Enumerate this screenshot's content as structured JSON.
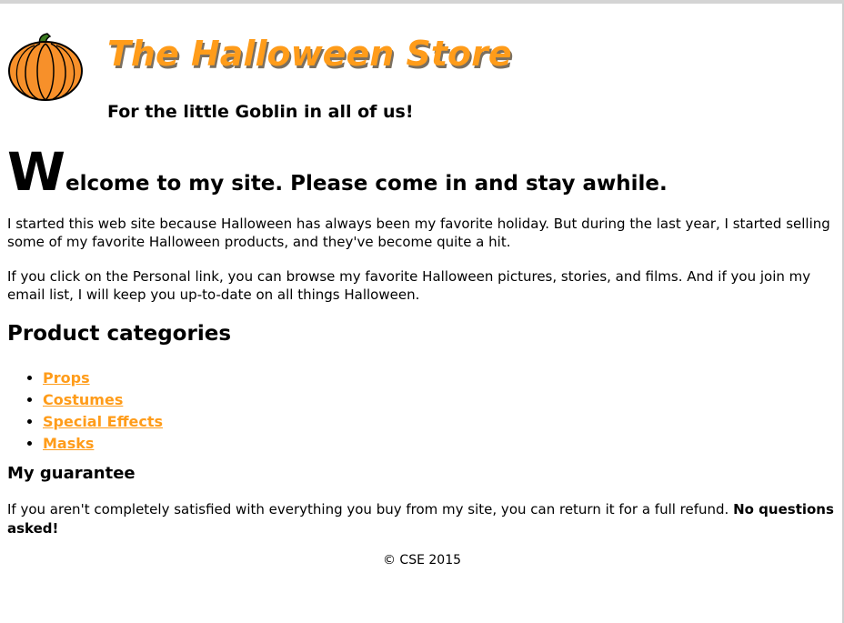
{
  "header": {
    "title": "The Halloween Store",
    "tagline": "For the little Goblin in all of us!",
    "logo_icon": "pumpkin-icon"
  },
  "welcome": {
    "drop_cap": "W",
    "rest": "elcome to my site. Please come in and stay awhile."
  },
  "intro": {
    "paragraph1": "I started this web site because Halloween has always been my favorite holiday. But during the last year, I started selling some of my favorite Halloween products, and they've become quite a hit.",
    "paragraph2": "If you click on the Personal link, you can browse my favorite Halloween pictures, stories, and films. And if you join my email list, I will keep you up-to-date on all things Halloween."
  },
  "categories": {
    "heading": "Product categories",
    "items": [
      {
        "label": "Props"
      },
      {
        "label": "Costumes"
      },
      {
        "label": "Special Effects"
      },
      {
        "label": "Masks"
      }
    ]
  },
  "guarantee": {
    "heading": "My guarantee",
    "text": "If you aren't completely satisfied with everything you buy from my site, you can return it for a full refund. ",
    "emphasis": "No questions asked!"
  },
  "footer": {
    "copyright": "© CSE 2015"
  },
  "colors": {
    "accent": "#ff9c1a",
    "title_shadow": "#7a6f60",
    "pumpkin_fill": "#f7902a",
    "pumpkin_stem": "#3a7a20"
  }
}
